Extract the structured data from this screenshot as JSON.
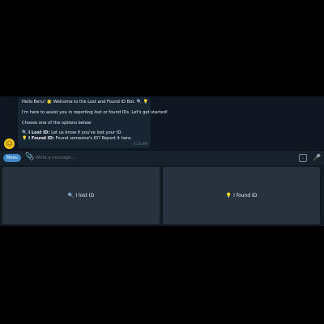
{
  "message": {
    "line1": "Hello Beru! 🌟 Welcome to the Lost and Found ID Bot. 🔍 💡",
    "line2": "I'm here to assist you in reporting lost or found IDs. Let's get started!",
    "line3": "Choose one of the options below:",
    "option1_icon": "🔍",
    "option1_bold": "I Lost ID:",
    "option1_text": " Let us know if you've lost your ID.",
    "option2_icon": "💡",
    "option2_bold": "I Found ID:",
    "option2_text": " Found someone's ID? Report it here.",
    "time": "5:13 AM"
  },
  "avatar": {
    "glyph": "😑",
    "color": "#f0c419"
  },
  "composer": {
    "menu_label": "Menu",
    "attach_icon": "📎",
    "placeholder": "Write a message...",
    "command_icon": "⌄",
    "mic_icon": "🎤"
  },
  "keyboard": {
    "lost_icon": "🔍",
    "lost_label": "I lost ID",
    "found_icon": "💡",
    "found_label": "I found ID"
  },
  "colors": {
    "accent": "#3e88c8",
    "bubble": "#182533",
    "background": "#0e1621"
  }
}
